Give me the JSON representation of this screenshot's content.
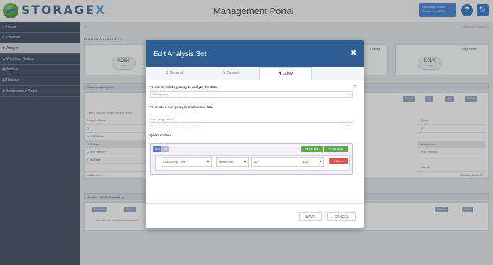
{
  "app": {
    "logo_text_main": "STORAGE",
    "logo_text_x": "X",
    "portal_title": "Management Portal",
    "app_status_line1": "Application Status",
    "app_status_line2": "Version 3.1.6173.3",
    "help_glyph": "?",
    "exit_glyph": "⎋"
  },
  "sidebar": {
    "items": [
      {
        "icon": "home-icon",
        "glyph": "⌂",
        "label": "Home",
        "active": false
      },
      {
        "icon": "search-icon",
        "glyph": "⚲",
        "label": "Discover",
        "active": false
      },
      {
        "icon": "analyze-icon",
        "glyph": "⚙",
        "label": "Analyze",
        "active": true
      },
      {
        "icon": "workload-icon",
        "glyph": "▲",
        "label": "Workload Tiering",
        "active": false
      },
      {
        "icon": "archive-icon",
        "glyph": "▣",
        "label": "Archive",
        "active": false
      },
      {
        "icon": "retrieve-icon",
        "glyph": "▤",
        "label": "Retrieve",
        "active": false
      },
      {
        "icon": "maintenance-icon",
        "glyph": "✖",
        "label": "Maintenance Portal",
        "active": false
      }
    ]
  },
  "page": {
    "crumb": "●",
    "section_title": "FOOTPRINT INSIGHTS",
    "shortlink": "Export file / Cancel to",
    "stat_left": "0.39",
    "stat_left_unit": "%",
    "stat_left_sub": "Stage",
    "stat_right": "0.01",
    "stat_right_unit": "%",
    "stat_right_sub": "Stage",
    "card_label_tiering": "Tiering",
    "card_label_migration": "Migration",
    "saved_sets_title": "Saved Analysis Sets",
    "table_toolbar": [
      "Create",
      "Edit",
      "Run",
      "Delete"
    ],
    "table_caption": "Drag a column header here to group",
    "table_col_name": "Analysis Name",
    "table_col_query": "Query",
    "table_rows": [
      {
        "name": "Q",
        "query": "Q"
      },
      {
        "name": "A Full Dataset",
        "query": ""
      },
      {
        "name": "D 28 Days",
        "query": "all days new"
      },
      {
        "name": "C Year Service",
        "query": "Year_Service"
      },
      {
        "name": "Y Big Table",
        "query": ""
      },
      {
        "name": "...",
        "query": "Not yet"
      }
    ],
    "total_items": "Total items: 5",
    "showing_items": "Showing items: 5",
    "results_title": "Analysis Results Powered by",
    "results_toolbar": [
      "Raw Data",
      "Report"
    ],
    "results_right": [
      "Refresh",
      "Export"
    ],
    "results_hint": "You need to select an analysis set"
  },
  "modal": {
    "title": "Edit Analysis Set",
    "close_glyph": "✖",
    "tabs": [
      {
        "glyph": "⚙",
        "label": "General"
      },
      {
        "glyph": "✎",
        "label": "Dataset"
      },
      {
        "glyph": "▼",
        "label": "Query"
      }
    ],
    "use_existing_label": "To use an existing query to analyze the data",
    "existing_select_value": "30 days new",
    "create_new_label": "To create a new query to analyze the data",
    "new_query_placeholder": "Enter query name *",
    "new_query_hint": "This is optional only if you want to create a new query",
    "new_query_counter": "0 / 200",
    "criteria_label": "Query Criteria",
    "and_label": "AND",
    "or_label": "OR",
    "add_rule_label": "✚ Add rule",
    "add_group_label": "✚ Add group",
    "rule_field": "Last Access Time",
    "rule_operator": "Newer than",
    "rule_value": "30",
    "rule_unit": "days",
    "delete_label": "✖ Delete",
    "save_label": "SAVE",
    "cancel_label": "CANCEL"
  },
  "colors": {
    "sidebar": "#3b4a5f",
    "modal_header": "#2f5d95",
    "accent_blue": "#2f6fc4",
    "add_green": "#5fa94c",
    "delete_red": "#d9534f"
  }
}
